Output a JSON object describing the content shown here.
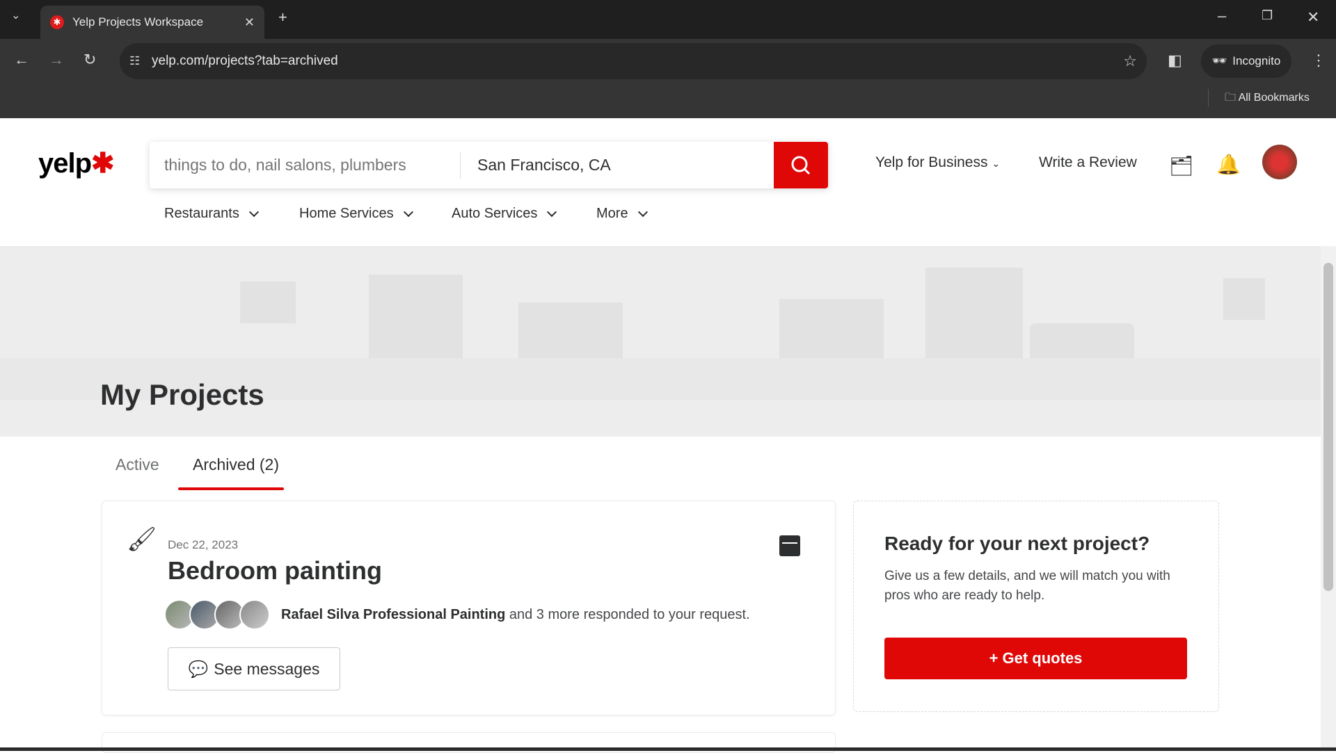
{
  "browser": {
    "tab_title": "Yelp Projects Workspace",
    "url": "yelp.com/projects?tab=archived",
    "profile": "Incognito",
    "bookmarks": "All Bookmarks"
  },
  "header": {
    "logo": "yelp",
    "search_placeholder": "things to do, nail salons, plumbers",
    "location": "San Francisco, CA",
    "business": "Yelp for Business",
    "write_review": "Write a Review"
  },
  "nav": [
    {
      "label": "Restaurants"
    },
    {
      "label": "Home Services"
    },
    {
      "label": "Auto Services"
    },
    {
      "label": "More"
    }
  ],
  "page": {
    "title": "My Projects",
    "tabs": [
      {
        "label": "Active"
      },
      {
        "label": "Archived (2)",
        "active": true
      }
    ]
  },
  "project": {
    "date": "Dec 22, 2023",
    "title": "Bedroom painting",
    "responder": "Rafael Silva Professional Painting",
    "response_text": " and 3 more responded to your request.",
    "button": "See messages"
  },
  "side": {
    "heading": "Ready for your next project?",
    "text": "Give us a few details, and we will match you with pros who are ready to help.",
    "button": "+ Get quotes"
  },
  "colors": {
    "brand": "#e00707"
  }
}
